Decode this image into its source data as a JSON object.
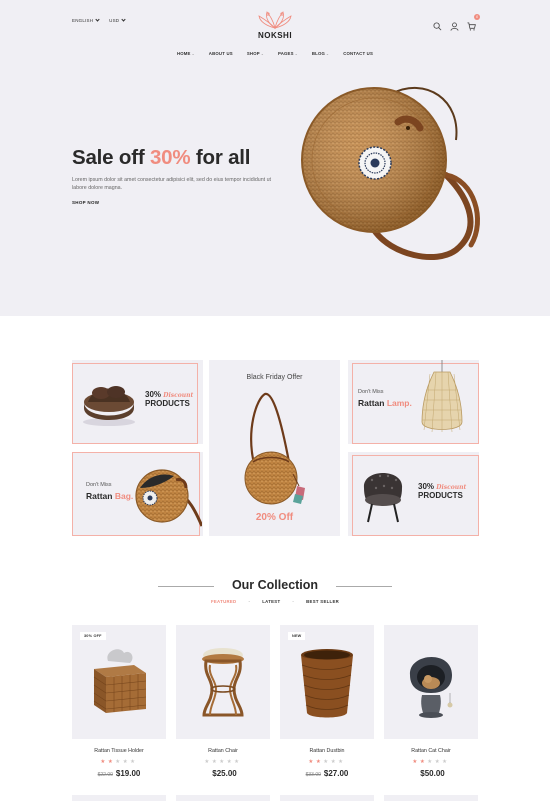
{
  "header": {
    "language": "ENGLISH",
    "currency": "USD",
    "logo_text": "NOKSHI",
    "cart_count": "0",
    "nav": [
      {
        "label": "HOME",
        "has_dropdown": true
      },
      {
        "label": "ABOUT US",
        "has_dropdown": false
      },
      {
        "label": "SHOP",
        "has_dropdown": true
      },
      {
        "label": "PAGES",
        "has_dropdown": true
      },
      {
        "label": "BLOG",
        "has_dropdown": true
      },
      {
        "label": "CONTACT US",
        "has_dropdown": false
      }
    ]
  },
  "hero": {
    "title_pre": "Sale off ",
    "title_pct": "30%",
    "title_post": " for all",
    "desc": "Lorem ipsum dolor sit amet consectetur adipisici elit, sed do eius tempor incididunt ut labore dolore magna.",
    "cta": "SHOP NOW"
  },
  "promo": {
    "card1": {
      "pct": "30%",
      "discount": "Discount",
      "products": "PRODUCTS"
    },
    "card2": {
      "dont_miss": "Don't Miss",
      "rattan": "Rattan",
      "item": "Lamp."
    },
    "card3": {
      "dont_miss": "Don't Miss",
      "rattan": "Rattan",
      "item": "Bag."
    },
    "card4": {
      "pct": "30%",
      "discount": "Discount",
      "products": "PRODUCTS"
    },
    "center": {
      "title": "Black Friday Offer",
      "off": "20% Off"
    }
  },
  "collection": {
    "title": "Our Collection",
    "tabs": [
      "FEATURED",
      "LATEST",
      "BEST SELLER"
    ],
    "tab_sep": "-",
    "products": [
      {
        "name": "Rattan Tissue Holder",
        "badge": "30% OFF",
        "old_price": "$22.00",
        "price": "$19.00",
        "rating": 2
      },
      {
        "name": "Rattan Chair",
        "badge": "",
        "old_price": "",
        "price": "$25.00",
        "rating": 0
      },
      {
        "name": "Rattan Dustbin",
        "badge": "NEW",
        "old_price": "$33.00",
        "price": "$27.00",
        "rating": 2
      },
      {
        "name": "Rattan Cat Chair",
        "badge": "",
        "old_price": "",
        "price": "$50.00",
        "rating": 2
      }
    ]
  },
  "colors": {
    "accent": "#f08c7f",
    "panel": "#f0eff4",
    "rattan": "#b97a3f"
  }
}
